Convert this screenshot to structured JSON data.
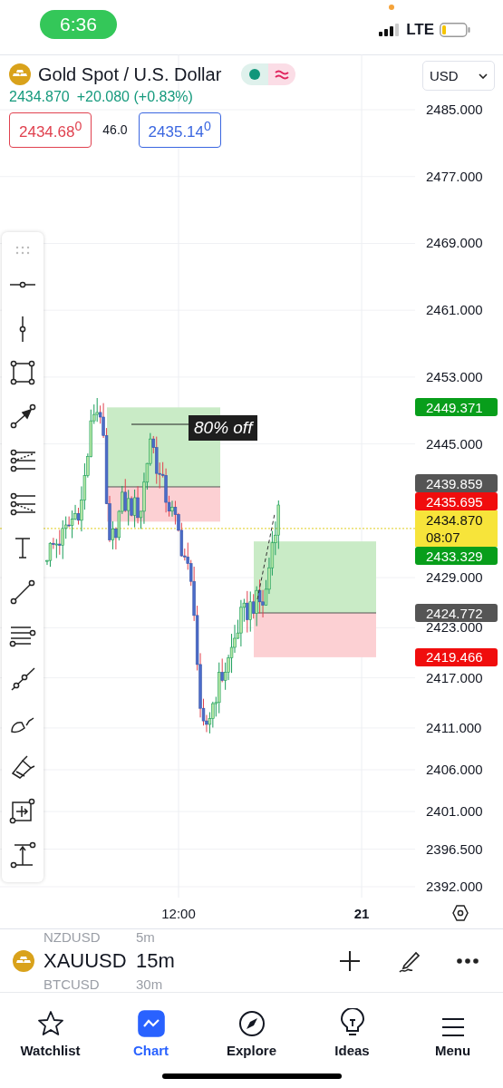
{
  "status_bar": {
    "time": "6:36",
    "network": "LTE"
  },
  "symbol_header": {
    "title": "Gold Spot / U.S. Dollar",
    "price": "2434.870",
    "change": "+20.080 (+0.83%)",
    "bid": "2434.68$^{0}$",
    "spread": "46.0",
    "ask": "2435.14$^{0}$"
  },
  "currency": "USD",
  "price_axis": {
    "ticks": [
      "2485.000",
      "2477.000",
      "2469.000",
      "2461.000",
      "2453.000",
      "2445.000",
      "2429.000",
      "2423.000",
      "2417.000",
      "2411.000",
      "2406.000",
      "2401.000",
      "2396.500",
      "2392.000"
    ],
    "tags": [
      {
        "text": "2449.371",
        "kind": "target"
      },
      {
        "text": "2439.859",
        "kind": "entry"
      },
      {
        "text": "2435.695",
        "kind": "stop"
      },
      {
        "text": "2434.870",
        "kind": "last",
        "countdown": "08:07"
      },
      {
        "text": "2433.329",
        "kind": "target"
      },
      {
        "text": "2424.772",
        "kind": "entry"
      },
      {
        "text": "2419.466",
        "kind": "stop"
      }
    ]
  },
  "annotation": {
    "text": "80% off"
  },
  "time_axis": [
    {
      "text": "12:00",
      "bold": false
    },
    {
      "text": "21",
      "bold": true
    }
  ],
  "symbol_picker": [
    {
      "symbol": "NZDUSD",
      "interval": "5m",
      "selected": false
    },
    {
      "symbol": "XAUUSD",
      "interval": "15m",
      "selected": true
    },
    {
      "symbol": "BTCUSD",
      "interval": "30m",
      "selected": false
    }
  ],
  "nav": [
    {
      "label": "Watchlist",
      "selected": false
    },
    {
      "label": "Chart",
      "selected": true
    },
    {
      "label": "Explore",
      "selected": false
    },
    {
      "label": "Ideas",
      "selected": false
    },
    {
      "label": "Menu",
      "selected": false
    }
  ]
}
